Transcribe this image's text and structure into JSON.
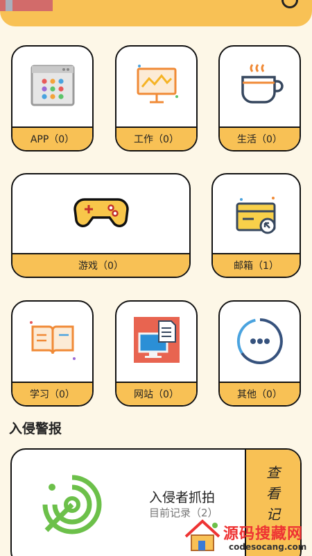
{
  "categories": [
    {
      "id": "app",
      "label": "APP（0）",
      "icon": "app-grid-icon"
    },
    {
      "id": "work",
      "label": "工作（0）",
      "icon": "presentation-board-icon"
    },
    {
      "id": "life",
      "label": "生活（0）",
      "icon": "coffee-cup-icon"
    },
    {
      "id": "game",
      "label": "游戏（0）",
      "icon": "gamepad-icon"
    },
    {
      "id": "mail",
      "label": "邮箱（1）",
      "icon": "mail-card-icon"
    },
    {
      "id": "study",
      "label": "学习（0）",
      "icon": "open-book-icon"
    },
    {
      "id": "website",
      "label": "网站（0）",
      "icon": "monitor-document-icon"
    },
    {
      "id": "other",
      "label": "其他（0）",
      "icon": "more-dots-icon"
    }
  ],
  "intrusion": {
    "section_title": "入侵警报",
    "card_title": "入侵者抓拍",
    "card_subtitle": "目前记录（2）",
    "side_button": [
      "查",
      "看",
      "记"
    ],
    "icon": "radar-icon"
  },
  "watermark": {
    "text": "源码搜藏网",
    "url": "codesocang.com"
  },
  "colors": {
    "accent": "#f8c155",
    "background": "#fdf7e7",
    "border": "#111111",
    "radar": "#6cc04a"
  }
}
